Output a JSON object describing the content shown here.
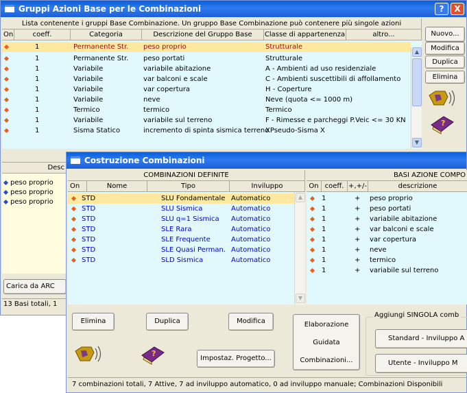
{
  "back_window": {
    "title": "Gruppi Azioni Base per le Combinazioni",
    "help_btn": "?",
    "close_btn": "X",
    "info_text": "Lista contenente i gruppi Base Combinazione. Un gruppo Base Combinazione può contenere più singole azioni",
    "columns": [
      "On",
      "coeff.",
      "Categoria",
      "Descrizione del Gruppo Base",
      "Classe di appartenenza",
      "altro..."
    ],
    "rows": [
      {
        "coeff": "1",
        "categoria": "Permanente Str.",
        "descrizione": "peso proprio",
        "classe": "Strutturale",
        "selected": true
      },
      {
        "coeff": "1",
        "categoria": "Permanente Str.",
        "descrizione": "peso portati",
        "classe": "Strutturale"
      },
      {
        "coeff": "1",
        "categoria": "Variabile",
        "descrizione": "variabile abitazione",
        "classe": "A - Ambienti ad uso residenziale"
      },
      {
        "coeff": "1",
        "categoria": "Variabile",
        "descrizione": "var balconi e scale",
        "classe": "C - Ambienti suscettibili di affollamento"
      },
      {
        "coeff": "1",
        "categoria": "Variabile",
        "descrizione": "var copertura",
        "classe": "H - Coperture"
      },
      {
        "coeff": "1",
        "categoria": "Variabile",
        "descrizione": "neve",
        "classe": "Neve (quota <= 1000 m)"
      },
      {
        "coeff": "1",
        "categoria": "Termico",
        "descrizione": "termico",
        "classe": "Termico"
      },
      {
        "coeff": "1",
        "categoria": "Variabile",
        "descrizione": "variabile sul terreno",
        "classe": "F - Rimesse e parcheggi P.Veic <= 30 KN"
      },
      {
        "coeff": "1",
        "categoria": "Sisma Statico",
        "descrizione": "incremento di spinta sismica terreno",
        "classe": "XPseudo-Sisma X"
      }
    ],
    "buttons": {
      "nuovo": "Nuovo...",
      "modifica": "Modifica",
      "duplica": "Duplica",
      "elimina": "Elimina"
    },
    "lower_header_partial": "Desc",
    "lower_items": [
      "peso proprio",
      "peso proprio",
      "peso proprio"
    ],
    "carica_button": "Carica da ARC",
    "status_text": "13 Basi totali, 1"
  },
  "front_window": {
    "title": "Costruzione Combinazioni",
    "left_section_header": "COMBINAZIONI  DEFINITE",
    "left_columns": [
      "On",
      "Nome",
      "Tipo",
      "Inviluppo"
    ],
    "combinations": [
      {
        "nome": "STD",
        "tipo": "SLU Fondamentale",
        "inviluppo": "Automatico",
        "selected": true
      },
      {
        "nome": "STD",
        "tipo": "SLU Sismica",
        "inviluppo": "Automatico"
      },
      {
        "nome": "STD",
        "tipo": "SLU q=1 Sismica",
        "inviluppo": "Automatico"
      },
      {
        "nome": "STD",
        "tipo": "SLE Rara",
        "inviluppo": "Automatico"
      },
      {
        "nome": "STD",
        "tipo": "SLE Frequente",
        "inviluppo": "Automatico"
      },
      {
        "nome": "STD",
        "tipo": "SLE Quasi Perman.",
        "inviluppo": "Automatico"
      },
      {
        "nome": "STD",
        "tipo": "SLD Sismica",
        "inviluppo": "Automatico"
      }
    ],
    "right_section_header": "BASI AZIONE COMPO",
    "right_columns": [
      "On",
      "coeff.",
      "+,+/-",
      "descrizione"
    ],
    "bases": [
      {
        "coeff": "1",
        "sign": "+",
        "descrizione": "peso proprio"
      },
      {
        "coeff": "1",
        "sign": "+",
        "descrizione": "peso portati"
      },
      {
        "coeff": "1",
        "sign": "+",
        "descrizione": "variabile abitazione"
      },
      {
        "coeff": "1",
        "sign": "+",
        "descrizione": "var balconi e scale"
      },
      {
        "coeff": "1",
        "sign": "+",
        "descrizione": "var copertura"
      },
      {
        "coeff": "1",
        "sign": "+",
        "descrizione": "neve"
      },
      {
        "coeff": "1",
        "sign": "+",
        "descrizione": "termico"
      },
      {
        "coeff": "1",
        "sign": "+",
        "descrizione": "variabile sul terreno"
      }
    ],
    "buttons": {
      "elimina": "Elimina",
      "duplica": "Duplica",
      "modifica": "Modifica",
      "impostaz": "Impostaz. Progetto...",
      "elab_1": "Elaborazione",
      "elab_2": "Guidata",
      "elab_3": "Combinazioni...",
      "standard": "Standard - Inviluppo A",
      "utente": "Utente - Inviluppo M"
    },
    "group_label": "Aggiungi SINGOLA comb",
    "status_text": "7 combinazioni totali, 7 Attive, 7 ad inviluppo automatico, 0 ad inviluppo manuale; Combinazioni  Disponibili"
  },
  "colors": {
    "title_blue": "#1d60d6",
    "list_bg": "#e1f9fc",
    "selected_row": "#ffe9a0",
    "diamond": "#e8601c",
    "link_blue": "#0000e0"
  },
  "icons": [
    "help-icon",
    "close-icon",
    "speaker-icon",
    "book-icon",
    "window-icon"
  ]
}
